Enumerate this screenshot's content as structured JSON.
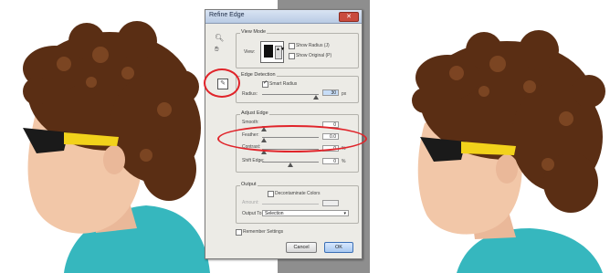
{
  "dialog": {
    "title": "Refine Edge",
    "close_icon": "close-icon",
    "view_mode": {
      "legend": "View Mode",
      "view_label": "View:",
      "show_radius_label": "Show Radius (J)",
      "show_original_label": "Show Original (P)"
    },
    "edge_detection": {
      "legend": "Edge Detection",
      "smart_radius_label": "Smart Radius",
      "radius_label": "Radius:",
      "radius_value": "30",
      "radius_unit": "px"
    },
    "adjust_edge": {
      "legend": "Adjust Edge",
      "smooth_label": "Smooth:",
      "smooth_value": "0",
      "feather_label": "Feather:",
      "feather_value": "0.0",
      "contrast_label": "Contrast:",
      "contrast_value": "0",
      "contrast_unit": "%",
      "shift_label": "Shift Edge:",
      "shift_value": "0",
      "shift_unit": "%"
    },
    "output": {
      "legend": "Output",
      "decontaminate_label": "Decontaminate Colors",
      "amount_label": "Amount:",
      "output_to_label": "Output To:",
      "output_to_value": "Selection"
    },
    "remember_label": "Remember Settings",
    "cancel_label": "Cancel",
    "ok_label": "OK"
  },
  "colors": {
    "annotation": "#e0242a",
    "hair": "#5a2e14",
    "skin": "#f2c7a8",
    "shirt": "#36b7be",
    "glasses_frame": "#f2d21b"
  },
  "icons": [
    "zoom-icon",
    "hand-icon",
    "refine-radius-brush-icon",
    "dropdown-icon"
  ]
}
